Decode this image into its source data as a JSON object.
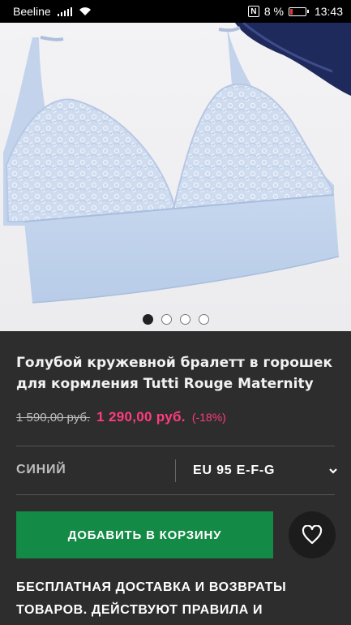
{
  "status_bar": {
    "carrier": "Beeline",
    "nfc": "N",
    "battery": "8 %",
    "time": "13:43"
  },
  "gallery": {
    "image_alt": "Blue lace maternity bralette",
    "dots": [
      {
        "active": true
      },
      {
        "active": false
      },
      {
        "active": false
      },
      {
        "active": false
      }
    ]
  },
  "product": {
    "title": "Голубой кружевной бралетт в горошек для кормления Tutti Rouge Maternity",
    "old_price": "1 590,00 руб.",
    "new_price": "1 290,00 руб.",
    "discount": "(-18%)"
  },
  "options": {
    "color": "СИНИЙ",
    "size": "EU 95 E-F-G"
  },
  "actions": {
    "add_to_cart": "ДОБАВИТЬ В КОРЗИНУ",
    "favorite_icon": "heart-icon"
  },
  "shipping": {
    "text": "БЕСПЛАТНАЯ ДОСТАВКА И ВОЗВРАТЫ ТОВАРОВ. ДЕЙСТВУЮТ ПРАВИЛА И"
  },
  "colors": {
    "accent_price": "#ff3c7d",
    "button_green": "#138a45",
    "panel_bg": "#2d2d2d"
  }
}
